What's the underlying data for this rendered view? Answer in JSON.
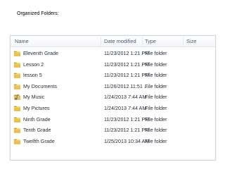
{
  "caption": "Organized Folders:",
  "columns": {
    "name": "Name",
    "date": "Date modified",
    "type": "Type",
    "size": "Size"
  },
  "rows": [
    {
      "icon": "folder-icon",
      "name": "Eleventh Grade",
      "date": "11/23/2012 1:21 PM",
      "type": "File folder"
    },
    {
      "icon": "folder-icon",
      "name": "Lesson 2",
      "date": "11/23/2012 1:21 PM",
      "type": "File folder"
    },
    {
      "icon": "folder-icon",
      "name": "lesson 5",
      "date": "11/23/2012 1:21 PM",
      "type": "File folder"
    },
    {
      "icon": "folder-icon",
      "name": "My Documents",
      "date": "11/26/2012 11:51 ...",
      "type": "File folder"
    },
    {
      "icon": "music-folder-icon",
      "name": "My Music",
      "date": "1/24/2013 7:44 AM",
      "type": "File folder"
    },
    {
      "icon": "folder-icon",
      "name": "My Pictures",
      "date": "1/24/2013 7:44 AM",
      "type": "File folder"
    },
    {
      "icon": "folder-icon",
      "name": "Ninth Grade",
      "date": "11/23/2012 1:21 PM",
      "type": "File folder"
    },
    {
      "icon": "folder-icon",
      "name": "Tenth Grade",
      "date": "11/23/2012 1:21 PM",
      "type": "File folder"
    },
    {
      "icon": "folder-icon",
      "name": "Twelfth Grade",
      "date": "1/25/2013 10:34 AM",
      "type": "File folder"
    }
  ],
  "colors": {
    "folder": "#e8c24a",
    "folder_dark": "#c99a22",
    "header_text": "#4a5a78",
    "row_text": "#1e2a3a"
  }
}
